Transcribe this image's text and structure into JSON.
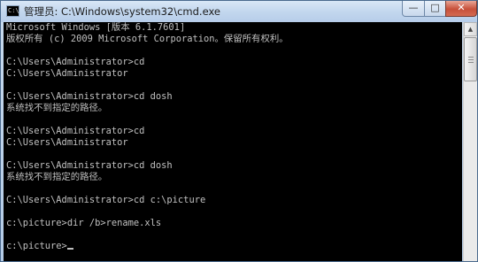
{
  "window": {
    "title": "管理员: C:\\Windows\\system32\\cmd.exe",
    "icon_text": "C:\\",
    "buttons": {
      "minimize": "—",
      "maximize": "□",
      "close": "✕"
    }
  },
  "console": {
    "lines": [
      "Microsoft Windows [版本 6.1.7601]",
      "版权所有 (c) 2009 Microsoft Corporation。保留所有权利。",
      "",
      "C:\\Users\\Administrator>cd",
      "C:\\Users\\Administrator",
      "",
      "C:\\Users\\Administrator>cd dosh",
      "系统找不到指定的路径。",
      "",
      "C:\\Users\\Administrator>cd",
      "C:\\Users\\Administrator",
      "",
      "C:\\Users\\Administrator>cd dosh",
      "系统找不到指定的路径。",
      "",
      "C:\\Users\\Administrator>cd c:\\picture",
      "",
      "c:\\picture>dir /b>rename.xls",
      "",
      "c:\\picture>"
    ]
  },
  "scrollbar": {
    "up_arrow": "▲"
  }
}
